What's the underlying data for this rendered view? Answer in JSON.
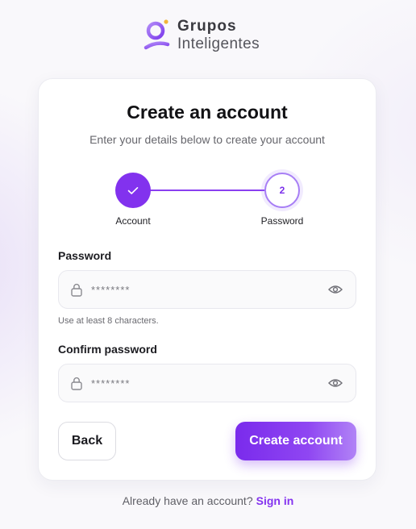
{
  "brand": {
    "name_line1": "Grupos",
    "name_line2": "Inteligentes",
    "accent_color": "#8232ee"
  },
  "card": {
    "title": "Create an account",
    "subtitle": "Enter your details below to create your account"
  },
  "stepper": {
    "steps": [
      {
        "label": "Account",
        "state": "completed",
        "icon": "check-icon"
      },
      {
        "label": "Password",
        "state": "current",
        "number": "2"
      }
    ]
  },
  "form": {
    "password": {
      "label": "Password",
      "placeholder": "********",
      "hint": "Use at least 8 characters."
    },
    "confirm_password": {
      "label": "Confirm password",
      "placeholder": "********"
    }
  },
  "actions": {
    "back_label": "Back",
    "create_label": "Create account"
  },
  "footer": {
    "prompt": "Already have an account?",
    "link_label": "Sign in"
  }
}
